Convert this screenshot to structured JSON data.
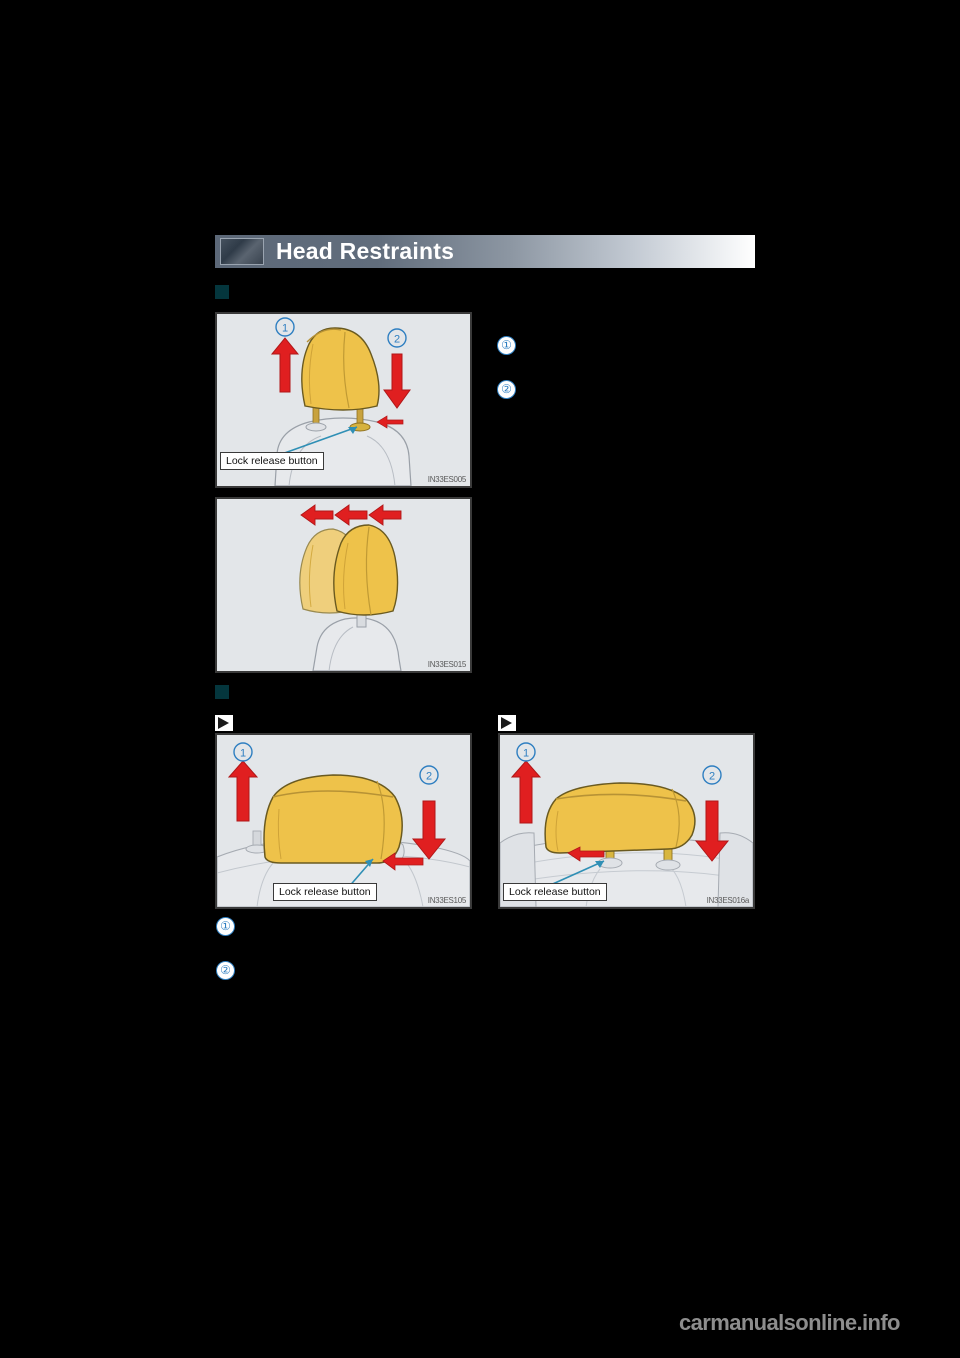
{
  "page": {
    "background_color": "#000000",
    "watermark": "carmanualsonline.info"
  },
  "header": {
    "title": "Head Restraints",
    "thumbnail_icon": "seat-thumbnail-icon",
    "gradient_from": "#5c6878",
    "gradient_to": "#ffffff"
  },
  "sections": [
    {
      "bullet_icon": "square-bullet",
      "bullet_color": "#04363d",
      "heading": "",
      "callouts": [
        {
          "marker": "1",
          "text": ""
        },
        {
          "marker": "2",
          "text": ""
        }
      ],
      "illustrations": [
        {
          "name": "front-seat-head-restraint-height-adjust",
          "code": "IN33ES005",
          "callout_label": "Lock release button",
          "arrows": [
            "up",
            "down",
            "press-left"
          ],
          "markers": [
            "1",
            "2"
          ]
        },
        {
          "name": "front-seat-head-restraint-tilt-adjust",
          "code": "IN33ES015",
          "callout_label": "",
          "arrows": [
            "left",
            "left",
            "left"
          ],
          "markers": []
        }
      ]
    },
    {
      "bullet_icon": "square-bullet",
      "bullet_color": "#04363d",
      "heading": "",
      "subsections": [
        {
          "marker_icon": "triangle-marker",
          "heading": ""
        },
        {
          "marker_icon": "triangle-marker",
          "heading": ""
        }
      ],
      "callouts": [
        {
          "marker": "1",
          "text": ""
        },
        {
          "marker": "2",
          "text": ""
        }
      ],
      "illustrations": [
        {
          "name": "rear-outboard-head-restraint-adjust",
          "code": "IN33ES105",
          "callout_label": "Lock release button",
          "arrows": [
            "up",
            "down",
            "press-left"
          ],
          "markers": [
            "1",
            "2"
          ]
        },
        {
          "name": "rear-center-head-restraint-adjust",
          "code": "IN33ES016a",
          "callout_label": "Lock release button",
          "arrows": [
            "up",
            "down",
            "press-left"
          ],
          "markers": [
            "1",
            "2"
          ]
        }
      ]
    }
  ],
  "colors": {
    "marker_blue": "#2f7fc1",
    "arrow_red": "#e01f20",
    "headrest_yellow": "#f0c040",
    "seat_gray": "#d8dade",
    "illus_bg": "#e3e6e9"
  }
}
